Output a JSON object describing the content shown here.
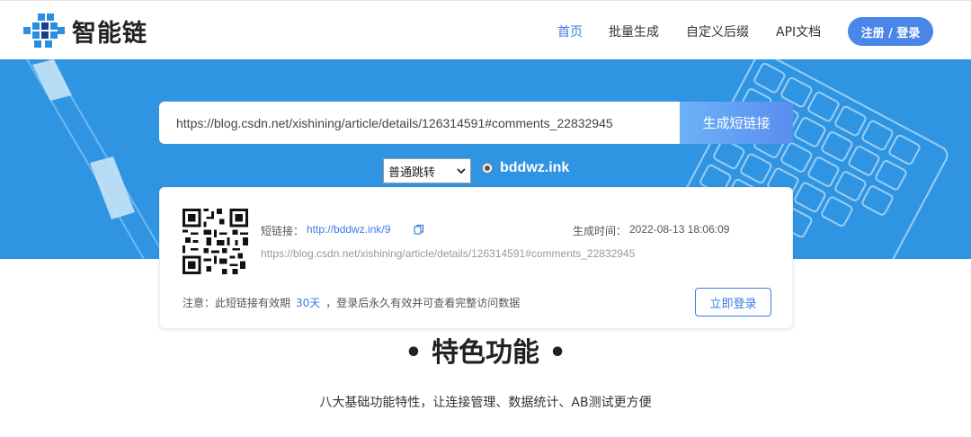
{
  "header": {
    "logo_text": "智能链",
    "nav": [
      "首页",
      "批量生成",
      "自定义后缀",
      "API文档"
    ],
    "login_label": "注册 / 登录"
  },
  "hero": {
    "url_value": "https://blog.csdn.net/xishining/article/details/126314591#comments_22832945",
    "generate_label": "生成短链接",
    "jump_type_selected": "普通跳转",
    "domain": "bddwz.ink"
  },
  "result": {
    "short_label": "短链接：",
    "short_link": "http://bddwz.ink/9",
    "time_label": "生成时间：",
    "time_value": "2022-08-13 18:06:09",
    "original_url": "https://blog.csdn.net/xishining/article/details/126314591#comments_22832945",
    "note_prefix": "注意：此短链接有效期",
    "note_days": "30天",
    "note_suffix": "，登录后永久有效并可查看完整访问数据",
    "login_label": "立即登录"
  },
  "features": {
    "title": "• 特色功能 •",
    "subtitle": "八大基础功能特性，让连接管理、数据统计、AB测试更方便"
  },
  "colors": {
    "hero_bg": "#2f95e3",
    "accent": "#3a7de1",
    "button_blue": "#4a86e8"
  }
}
